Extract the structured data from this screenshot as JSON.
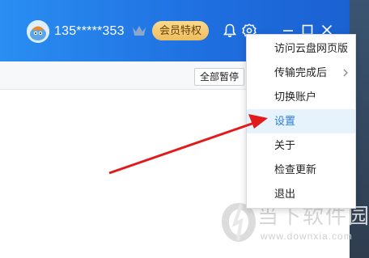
{
  "header": {
    "username": "135*****353",
    "vip_label": "会员特权"
  },
  "toolbar": {
    "pause_all_label": "全部暂停"
  },
  "menu": {
    "items": [
      {
        "label": "访问云盘网页版"
      },
      {
        "label": "传输完成后",
        "has_submenu": true
      },
      {
        "label": "切换账户"
      },
      {
        "label": "设置",
        "highlighted": true
      },
      {
        "label": "关于"
      },
      {
        "label": "检查更新"
      },
      {
        "label": "退出"
      }
    ]
  },
  "watermark": {
    "text_cn": "当下软件园",
    "url": "www.downxia.com"
  },
  "colors": {
    "titlebar": "#1f6fe0",
    "vip_gold": "#efbd5d",
    "menu_highlight": "#e6f3fd",
    "annotation_arrow": "#e11b1b"
  }
}
